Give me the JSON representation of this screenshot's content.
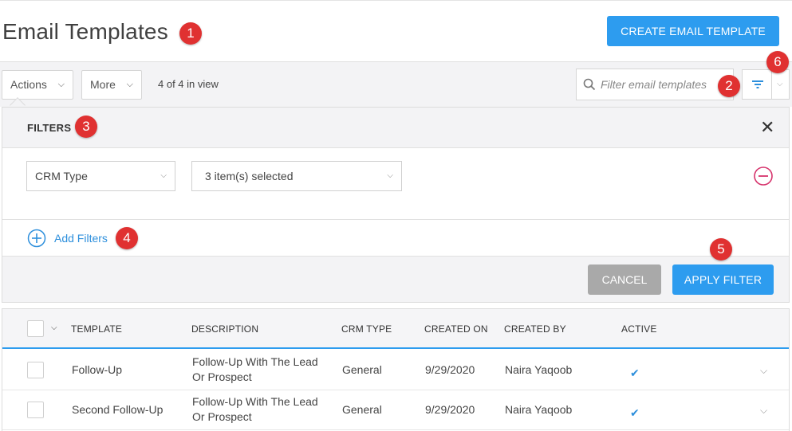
{
  "header": {
    "title": "Email Templates",
    "create_button": "CREATE EMAIL TEMPLATE"
  },
  "toolbar": {
    "actions_label": "Actions",
    "more_label": "More",
    "in_view_text": "4 of 4 in view",
    "search_placeholder": "Filter email templates"
  },
  "filters": {
    "title": "FILTERS",
    "field": "CRM Type",
    "value": "3 item(s) selected",
    "add_label": "Add Filters",
    "cancel_label": "CANCEL",
    "apply_label": "APPLY FILTER"
  },
  "callouts": [
    "1",
    "2",
    "3",
    "4",
    "5",
    "6"
  ],
  "table": {
    "columns": [
      "TEMPLATE",
      "DESCRIPTION",
      "CRM TYPE",
      "CREATED ON",
      "CREATED BY",
      "ACTIVE"
    ],
    "rows": [
      {
        "template": "Follow-Up",
        "description": "Follow-Up With The Lead Or Prospect",
        "crm_type": "General",
        "created_on": "9/29/2020",
        "created_by": "Naira Yaqoob",
        "active": true
      },
      {
        "template": "Second Follow-Up",
        "description": "Follow-Up With The Lead Or Prospect",
        "crm_type": "General",
        "created_on": "9/29/2020",
        "created_by": "Naira Yaqoob",
        "active": true
      }
    ]
  },
  "icons": {
    "search": "search-icon",
    "filter": "filter-icon",
    "close": "close-icon",
    "remove": "minus-circle-icon",
    "add": "plus-circle-icon",
    "check": "check-icon"
  },
  "colors": {
    "primary": "#2d9cef",
    "badge": "#e03131",
    "remove": "#d6336c",
    "cancel": "#a9a9a9"
  }
}
